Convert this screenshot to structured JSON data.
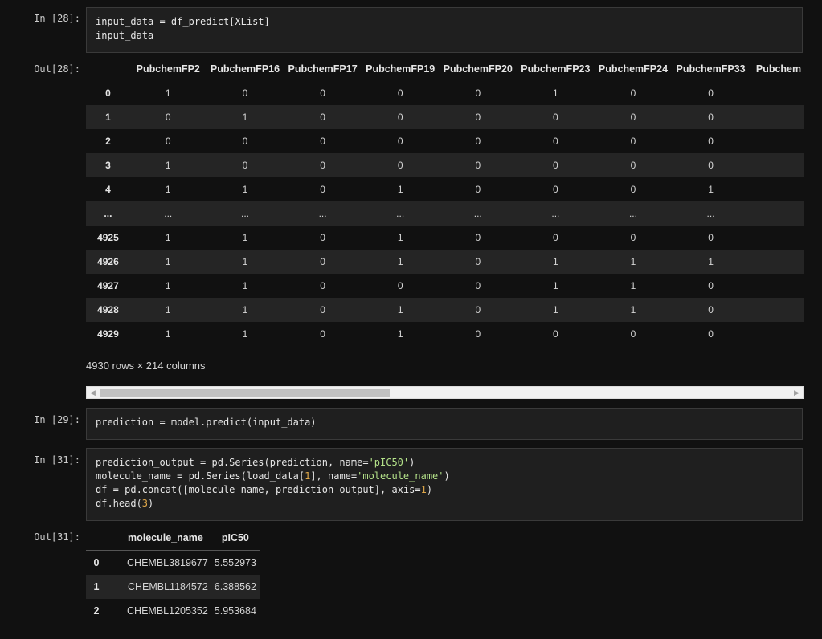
{
  "cells": [
    {
      "prompt": "In [28]:",
      "lines": [
        "input_data = df_predict[XList]",
        "input_data"
      ]
    },
    {
      "prompt": "In [29]:",
      "lines": [
        "prediction = model.predict(input_data)"
      ]
    },
    {
      "prompt": "In [31]:"
    }
  ],
  "cell31": {
    "l1a": "prediction_output = pd.Series(prediction, name=",
    "l1s": "'pIC50'",
    "l1b": ")",
    "l2a": "molecule_name = pd.Series(load_data[",
    "l2n": "1",
    "l2b": "], name=",
    "l2s": "'molecule_name'",
    "l2c": ")",
    "l3a": "df = pd.concat([molecule_name, prediction_output], axis=",
    "l3n": "1",
    "l3b": ")",
    "l4a": "df.head(",
    "l4n": "3",
    "l4b": ")"
  },
  "out28": {
    "prompt": "Out[28]:",
    "columns": [
      "PubchemFP2",
      "PubchemFP16",
      "PubchemFP17",
      "PubchemFP19",
      "PubchemFP20",
      "PubchemFP23",
      "PubchemFP24",
      "PubchemFP33",
      "Pubchem"
    ],
    "rows": [
      {
        "idx": "0",
        "vals": [
          "1",
          "0",
          "0",
          "0",
          "0",
          "1",
          "0",
          "0"
        ]
      },
      {
        "idx": "1",
        "vals": [
          "0",
          "1",
          "0",
          "0",
          "0",
          "0",
          "0",
          "0"
        ]
      },
      {
        "idx": "2",
        "vals": [
          "0",
          "0",
          "0",
          "0",
          "0",
          "0",
          "0",
          "0"
        ]
      },
      {
        "idx": "3",
        "vals": [
          "1",
          "0",
          "0",
          "0",
          "0",
          "0",
          "0",
          "0"
        ]
      },
      {
        "idx": "4",
        "vals": [
          "1",
          "1",
          "0",
          "1",
          "0",
          "0",
          "0",
          "1"
        ]
      },
      {
        "idx": "...",
        "vals": [
          "...",
          "...",
          "...",
          "...",
          "...",
          "...",
          "...",
          "..."
        ]
      },
      {
        "idx": "4925",
        "vals": [
          "1",
          "1",
          "0",
          "1",
          "0",
          "0",
          "0",
          "0"
        ]
      },
      {
        "idx": "4926",
        "vals": [
          "1",
          "1",
          "0",
          "1",
          "0",
          "1",
          "1",
          "1"
        ]
      },
      {
        "idx": "4927",
        "vals": [
          "1",
          "1",
          "0",
          "0",
          "0",
          "1",
          "1",
          "0"
        ]
      },
      {
        "idx": "4928",
        "vals": [
          "1",
          "1",
          "0",
          "1",
          "0",
          "1",
          "1",
          "0"
        ]
      },
      {
        "idx": "4929",
        "vals": [
          "1",
          "1",
          "0",
          "1",
          "0",
          "0",
          "0",
          "0"
        ]
      }
    ],
    "shape": "4930 rows × 214 columns"
  },
  "out31": {
    "prompt": "Out[31]:",
    "columns": [
      "molecule_name",
      "pIC50"
    ],
    "rows": [
      {
        "idx": "0",
        "name": "CHEMBL3819677",
        "pic50": "5.552973"
      },
      {
        "idx": "1",
        "name": "CHEMBL1184572",
        "pic50": "6.388562"
      },
      {
        "idx": "2",
        "name": "CHEMBL1205352",
        "pic50": "5.953684"
      }
    ]
  },
  "scrollbar": {
    "left_arrow": "◀",
    "right_arrow": "▶"
  }
}
